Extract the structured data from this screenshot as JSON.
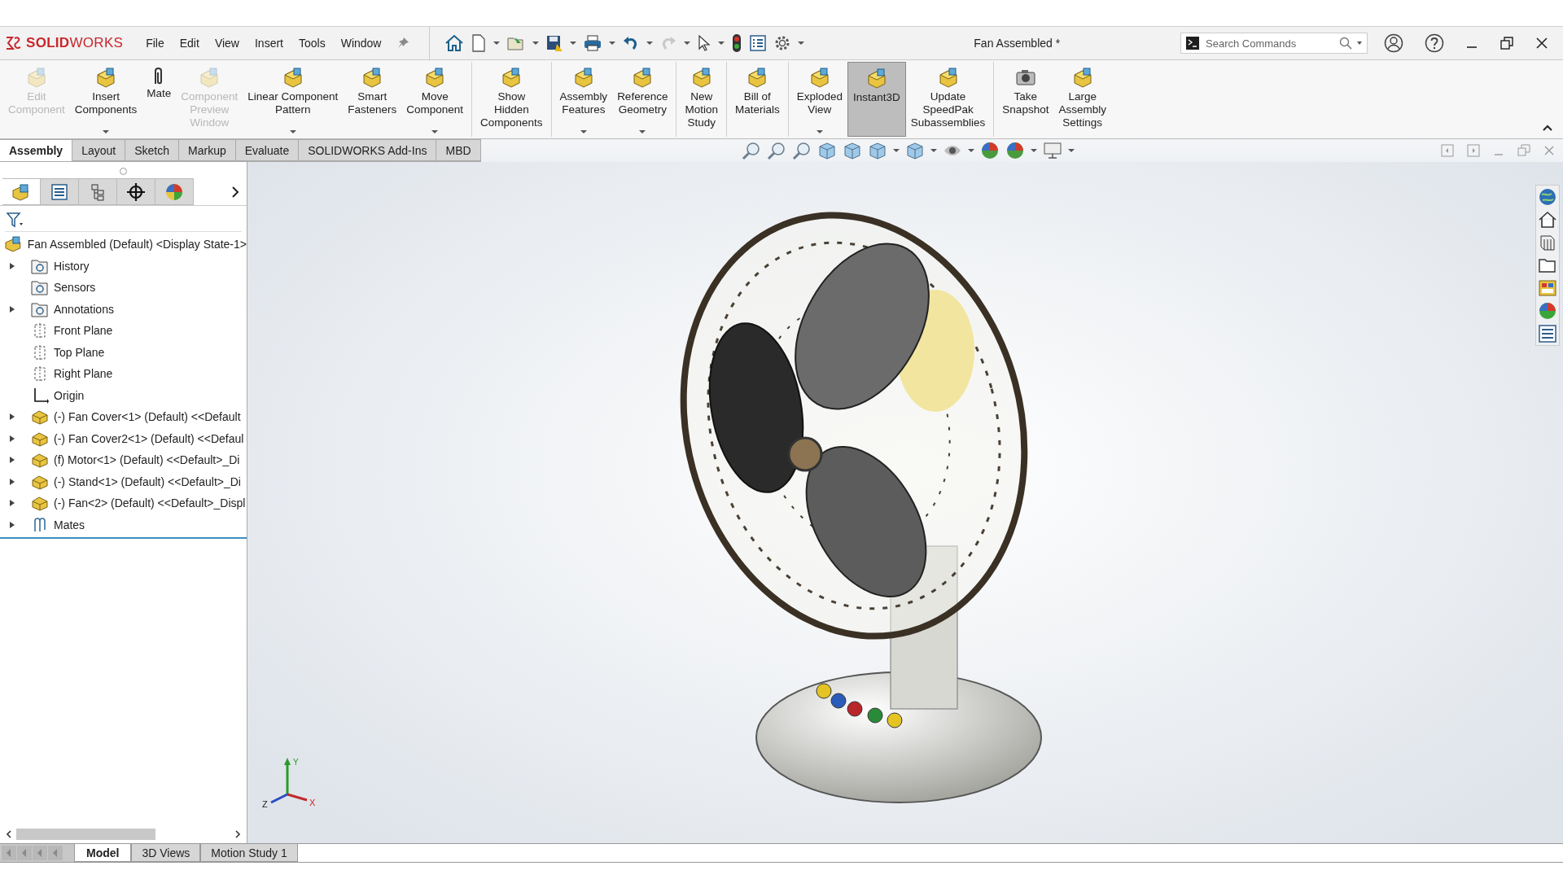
{
  "app": {
    "logo": "**SOLID**WORKS"
  },
  "menu": [
    "File",
    "Edit",
    "View",
    "Insert",
    "Tools",
    "Window"
  ],
  "document_title": "Fan Assembled *",
  "search": {
    "placeholder": "Search Commands"
  },
  "ribbon": [
    {
      "lines": [
        "Edit",
        "Component"
      ],
      "disabled": true,
      "dropdown": false,
      "selected": false,
      "separator_after": false
    },
    {
      "lines": [
        "Insert",
        "Components"
      ],
      "disabled": false,
      "dropdown": true,
      "selected": false,
      "separator_after": false
    },
    {
      "lines": [
        "Mate"
      ],
      "disabled": false,
      "dropdown": false,
      "selected": false,
      "separator_after": false
    },
    {
      "lines": [
        "Component",
        "Preview",
        "Window"
      ],
      "disabled": true,
      "dropdown": false,
      "selected": false,
      "separator_after": false
    },
    {
      "lines": [
        "Linear Component",
        "Pattern"
      ],
      "disabled": false,
      "dropdown": true,
      "selected": false,
      "separator_after": false
    },
    {
      "lines": [
        "Smart",
        "Fasteners"
      ],
      "disabled": false,
      "dropdown": false,
      "selected": false,
      "separator_after": false
    },
    {
      "lines": [
        "Move",
        "Component"
      ],
      "disabled": false,
      "dropdown": true,
      "selected": false,
      "separator_after": true
    },
    {
      "lines": [
        "Show",
        "Hidden",
        "Components"
      ],
      "disabled": false,
      "dropdown": false,
      "selected": false,
      "separator_after": true
    },
    {
      "lines": [
        "Assembly",
        "Features"
      ],
      "disabled": false,
      "dropdown": true,
      "selected": false,
      "separator_after": false
    },
    {
      "lines": [
        "Reference",
        "Geometry"
      ],
      "disabled": false,
      "dropdown": true,
      "selected": false,
      "separator_after": true
    },
    {
      "lines": [
        "New",
        "Motion",
        "Study"
      ],
      "disabled": false,
      "dropdown": false,
      "selected": false,
      "separator_after": true
    },
    {
      "lines": [
        "Bill of",
        "Materials"
      ],
      "disabled": false,
      "dropdown": false,
      "selected": false,
      "separator_after": true
    },
    {
      "lines": [
        "Exploded",
        "View"
      ],
      "disabled": false,
      "dropdown": true,
      "selected": false,
      "separator_after": false
    },
    {
      "lines": [
        "Instant3D"
      ],
      "disabled": false,
      "dropdown": false,
      "selected": true,
      "separator_after": false
    },
    {
      "lines": [
        "Update",
        "SpeedPak",
        "Subassemblies"
      ],
      "disabled": false,
      "dropdown": false,
      "selected": false,
      "separator_after": true
    },
    {
      "lines": [
        "Take",
        "Snapshot"
      ],
      "disabled": false,
      "dropdown": false,
      "selected": false,
      "separator_after": false
    },
    {
      "lines": [
        "Large",
        "Assembly",
        "Settings"
      ],
      "disabled": false,
      "dropdown": false,
      "selected": false,
      "separator_after": false
    }
  ],
  "command_tabs": [
    {
      "label": "Assembly",
      "selected": true
    },
    {
      "label": "Layout",
      "selected": false
    },
    {
      "label": "Sketch",
      "selected": false
    },
    {
      "label": "Markup",
      "selected": false
    },
    {
      "label": "Evaluate",
      "selected": false
    },
    {
      "label": "SOLIDWORKS Add-Ins",
      "selected": false
    },
    {
      "label": "MBD",
      "selected": false
    }
  ],
  "panel_tabs": [
    {
      "selected": true
    },
    {
      "selected": false
    },
    {
      "selected": false
    },
    {
      "selected": false
    },
    {
      "selected": false
    }
  ],
  "tree": {
    "label": "Fan Assembled (Default) <Display State-1>",
    "children": [
      {
        "kind": "folder",
        "label": "History",
        "expandable": true
      },
      {
        "kind": "folder",
        "label": "Sensors",
        "expandable": false
      },
      {
        "kind": "folder",
        "label": "Annotations",
        "expandable": true
      },
      {
        "kind": "plane",
        "label": "Front Plane",
        "expandable": false
      },
      {
        "kind": "plane",
        "label": "Top Plane",
        "expandable": false
      },
      {
        "kind": "plane",
        "label": "Right Plane",
        "expandable": false
      },
      {
        "kind": "origin",
        "label": "Origin",
        "expandable": false
      },
      {
        "kind": "part",
        "label": "(-) Fan Cover<1> (Default) <<Default",
        "expandable": true
      },
      {
        "kind": "part",
        "label": "(-) Fan Cover2<1> (Default) <<Defaul",
        "expandable": true
      },
      {
        "kind": "part",
        "label": "(f) Motor<1> (Default) <<Default>_Di",
        "expandable": true
      },
      {
        "kind": "part",
        "label": "(-) Stand<1> (Default) <<Default>_Di",
        "expandable": true
      },
      {
        "kind": "part",
        "label": "(-) Fan<2> (Default) <<Default>_Displ",
        "expandable": true
      },
      {
        "kind": "mates",
        "label": "Mates",
        "expandable": true
      }
    ]
  },
  "viewport": {
    "triad_labels": [
      "Y",
      "Z",
      "X"
    ]
  },
  "bottom_tabs": [
    {
      "label": "Model",
      "selected": true
    },
    {
      "label": "3D Views",
      "selected": false
    },
    {
      "label": "Motion Study 1",
      "selected": false
    }
  ]
}
